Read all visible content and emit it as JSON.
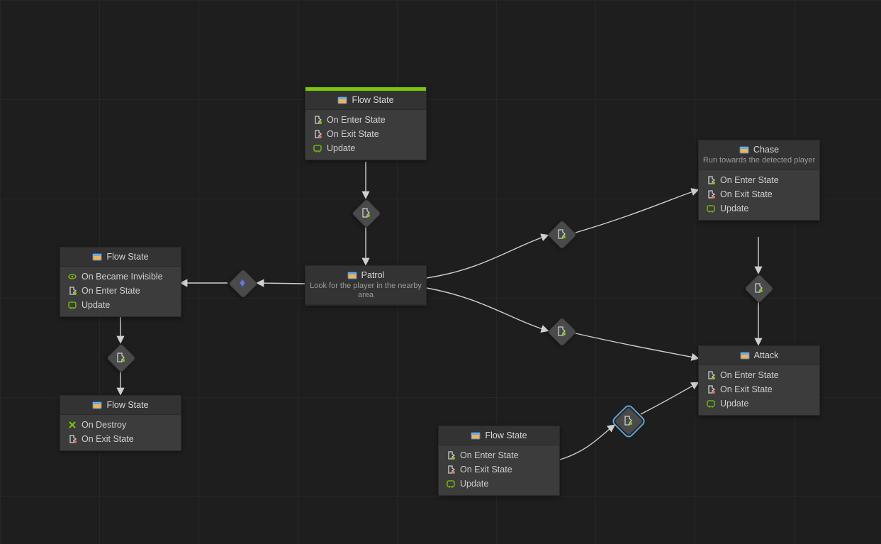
{
  "nodes": {
    "flowTop": {
      "title": "Flow State",
      "ports": [
        "On Enter State",
        "On Exit State",
        "Update"
      ],
      "hasStart": true
    },
    "patrol": {
      "title": "Patrol",
      "subtitle": "Look for the player in the nearby area"
    },
    "chase": {
      "title": "Chase",
      "subtitle": "Run towards the detected player",
      "ports": [
        "On Enter State",
        "On Exit State",
        "Update"
      ]
    },
    "attack": {
      "title": "Attack",
      "ports": [
        "On Enter State",
        "On Exit State",
        "Update"
      ]
    },
    "flowLeft": {
      "title": "Flow State",
      "ports": [
        "On Became Invisible",
        "On Enter State",
        "Update"
      ]
    },
    "flowLeftBottom": {
      "title": "Flow State",
      "ports": [
        "On Destroy",
        "On Exit State"
      ]
    },
    "flowBottom": {
      "title": "Flow State",
      "ports": [
        "On Enter State",
        "On Exit State",
        "Update"
      ]
    }
  }
}
